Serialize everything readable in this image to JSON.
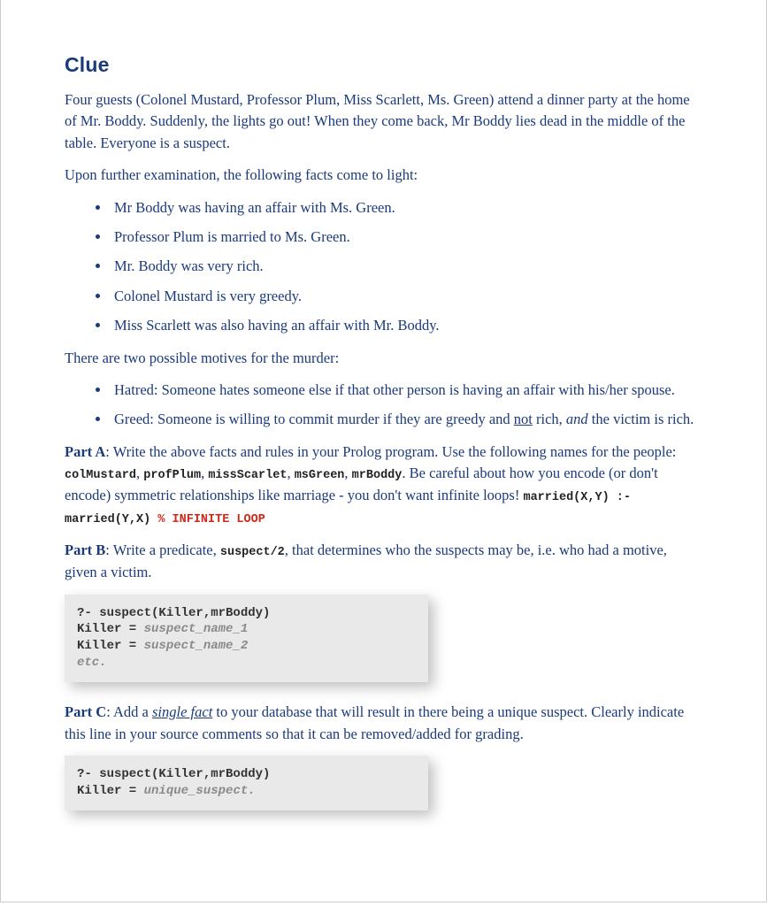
{
  "title": "Clue",
  "intro": "Four guests (Colonel Mustard, Professor Plum, Miss Scarlett, Ms. Green) attend a dinner party at the home of Mr. Boddy. Suddenly, the lights go out! When they come back, Mr Boddy lies dead in the middle of the table. Everyone is a suspect.",
  "facts_lead": "Upon further examination, the following facts come to light:",
  "facts": [
    "Mr Boddy was having an affair with Ms. Green.",
    "Professor Plum is married to Ms. Green.",
    "Mr. Boddy was very rich.",
    "Colonel Mustard is very greedy.",
    "Miss Scarlett was also having an affair with Mr. Boddy."
  ],
  "motives_lead": "There are two possible motives for the murder:",
  "motives": {
    "hatred": "Hatred: Someone hates someone else if that other person is having an affair with his/her spouse.",
    "greed_pre": "Greed: Someone is willing to commit murder if they are greedy and ",
    "greed_not": "not",
    "greed_mid": " rich, ",
    "greed_and": "and",
    "greed_post": " the victim is rich."
  },
  "partA": {
    "label": "Part A",
    "pre": ": Write the above facts and rules in your Prolog program. Use the following names for the people: ",
    "names": [
      "colMustard",
      "profPlum",
      "missScarlet",
      "msGreen",
      "mrBoddy"
    ],
    "sep": ", ",
    "post_names": ". Be careful about how you encode (or don't encode) symmetric relationships like marriage - you don't want infinite loops! ",
    "loop_code": "married(X,Y) :- married(Y,X)",
    "loop_warn": " % INFINITE LOOP"
  },
  "partB": {
    "label": "Part B",
    "pre": ": Write a predicate, ",
    "pred": "suspect/2",
    "post": ", that determines who the suspects may be, i.e. who had a motive, given a victim."
  },
  "codeB": {
    "q": "?- suspect(Killer,mrBoddy)",
    "k1a": "Killer = ",
    "k1b": "suspect_name_1",
    "k2a": "Killer = ",
    "k2b": "suspect_name_2",
    "etc": "etc."
  },
  "partC": {
    "label": "Part C",
    "pre": ": Add a ",
    "sf": "single fact",
    "post": " to your database that will result in there being a unique suspect. Clearly indicate this line in your source comments so that it can be removed/added for grading."
  },
  "codeC": {
    "q": "?- suspect(Killer,mrBoddy)",
    "ka": "Killer = ",
    "kb": "unique_suspect."
  }
}
